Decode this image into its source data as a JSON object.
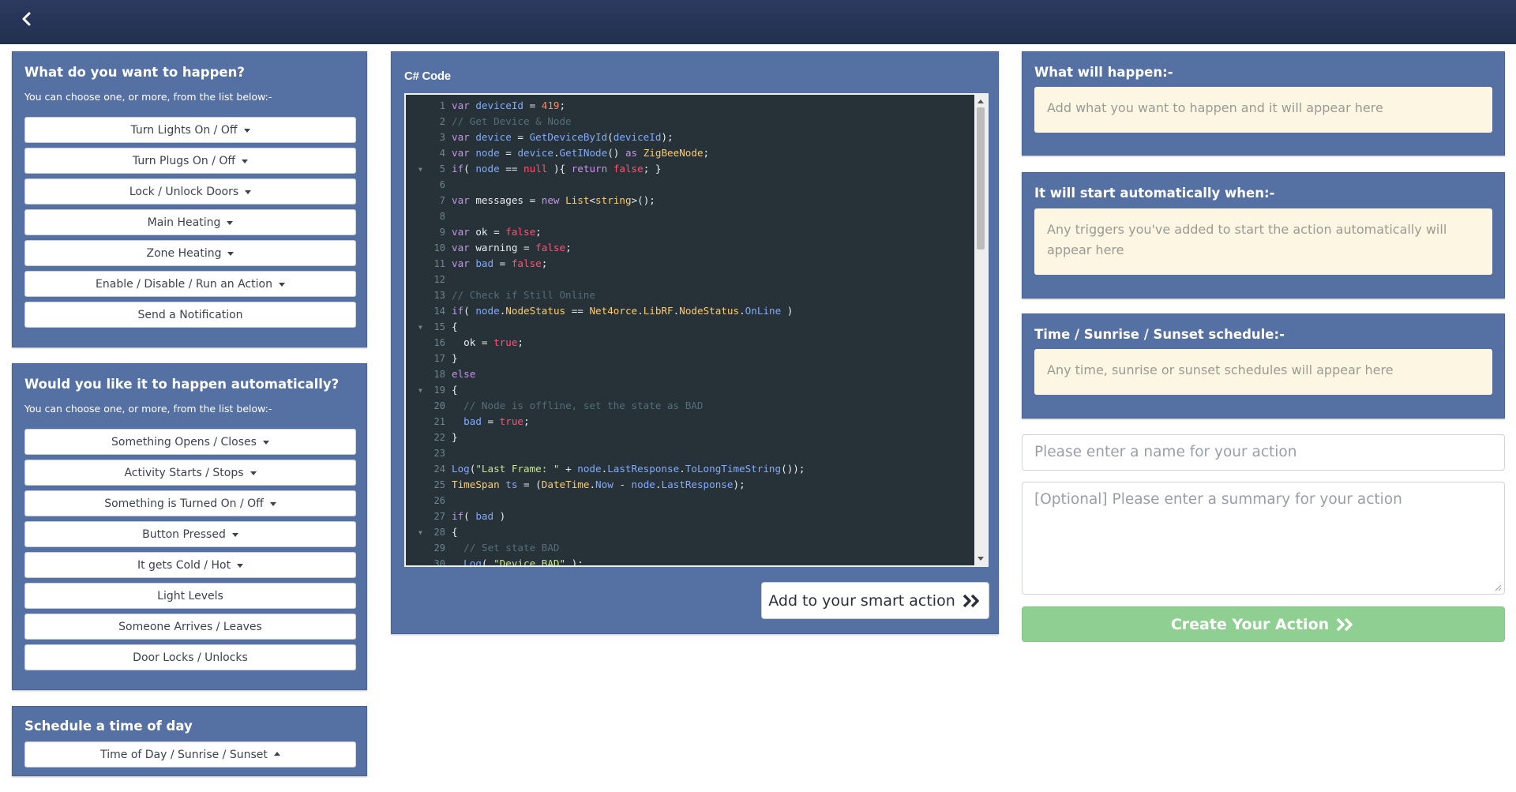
{
  "topbar": {
    "back_icon": "chevron-left-icon"
  },
  "left": {
    "happen": {
      "title": "What do you want to happen?",
      "subtitle": "You can choose one, or more, from the list below:-",
      "buttons": [
        {
          "label": "Turn Lights On / Off",
          "dropdown": true
        },
        {
          "label": "Turn Plugs On / Off",
          "dropdown": true
        },
        {
          "label": "Lock / Unlock Doors",
          "dropdown": true
        },
        {
          "label": "Main Heating",
          "dropdown": true
        },
        {
          "label": "Zone Heating",
          "dropdown": true
        },
        {
          "label": "Enable / Disable / Run an Action",
          "dropdown": true
        },
        {
          "label": "Send a Notification",
          "dropdown": false
        }
      ]
    },
    "auto": {
      "title": "Would you like it to happen automatically?",
      "subtitle": "You can choose one, or more, from the list below:-",
      "buttons": [
        {
          "label": "Something Opens / Closes",
          "dropdown": true
        },
        {
          "label": "Activity Starts / Stops",
          "dropdown": true
        },
        {
          "label": "Something is Turned On / Off",
          "dropdown": true
        },
        {
          "label": "Button Pressed",
          "dropdown": true
        },
        {
          "label": "It gets Cold / Hot",
          "dropdown": true
        },
        {
          "label": "Light Levels",
          "dropdown": false
        },
        {
          "label": "Someone Arrives / Leaves",
          "dropdown": false
        },
        {
          "label": "Door Locks / Unlocks",
          "dropdown": false
        }
      ]
    },
    "schedule": {
      "title": "Schedule a time of day",
      "button": {
        "label": "Time of Day / Sunrise / Sunset",
        "caret": "up"
      }
    }
  },
  "code_panel": {
    "title": "C# Code",
    "add_button": "Add to your smart action",
    "lines": [
      "var deviceId = 419;",
      "// Get Device & Node",
      "var device = GetDeviceById(deviceId);",
      "var node = device.GetINode() as ZigBeeNode;",
      "if( node == null ){ return false; }",
      "",
      "var messages = new List<string>();",
      "",
      "var ok = false;",
      "var warning = false;",
      "var bad = false;",
      "",
      "// Check if Still Online",
      "if( node.NodeStatus == Net4orce.LibRF.NodeStatus.OnLine )",
      "{",
      "  ok = true;",
      "}",
      "else",
      "{",
      "  // Node is offline, set the state as BAD",
      "  bad = true;",
      "}",
      "",
      "Log(\"Last Frame: \" + node.LastResponse.ToLongTimeString());",
      "TimeSpan ts = (DateTime.Now - node.LastResponse);",
      "",
      "if( bad )",
      "{",
      "  // Set state BAD",
      "  Log( \"Device BAD\" );"
    ],
    "fold_lines": [
      5,
      15,
      19,
      28
    ]
  },
  "right": {
    "what": {
      "title": "What will happen:-",
      "placeholder": "Add what you want to happen and it will appear here"
    },
    "start": {
      "title": "It will start automatically when:-",
      "placeholder": "Any triggers you've added to start the action automatically will appear here"
    },
    "time": {
      "title": "Time / Sunrise / Sunset schedule:-",
      "placeholder": "Any time, sunrise or sunset schedules will appear here"
    },
    "name_placeholder": "Please enter a name for your action",
    "summary_placeholder": "[Optional] Please enter a summary for your action",
    "create_button": "Create Your Action"
  }
}
